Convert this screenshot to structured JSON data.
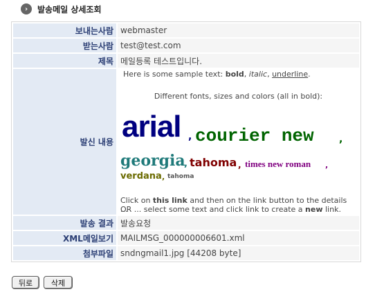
{
  "header": {
    "title": "발송메일 상세조회",
    "icon": "arrow-right-circle-icon"
  },
  "fields": {
    "sender_label": "보내는사람",
    "sender_value": "webmaster",
    "recipient_label": "받는사람",
    "recipient_value": "test@test.com",
    "subject_label": "제목",
    "subject_value": "메일등록 테스트입니다.",
    "content_label": "발신 내용",
    "result_label": "발송 결과",
    "result_value": "발송요청",
    "xml_label": "XML메일보기",
    "xml_value": "MAILMSG_000000006601.xml",
    "attach_label": "첨부파일",
    "attach_value": "sndngmail1.jpg [44208 byte]"
  },
  "content": {
    "intro_prefix": "Here is some sample text: ",
    "bold": "bold",
    "sep1": ", ",
    "italic": "italic",
    "sep2": ", ",
    "underline": "underline",
    "end": ".",
    "fonts_caption": "Different fonts, sizes and colors (all in bold):",
    "font_arial": "arial",
    "font_courier": "courier new",
    "font_georgia": "georgia",
    "font_tahoma": "tahoma",
    "font_times": "times new roman",
    "font_verdana": "verdana",
    "font_tahoma_small": "tahoma",
    "comma": ",",
    "link_line_prefix": "Click on ",
    "link_text": "this link",
    "link_line_suffix": " and then on the link button to the details ...",
    "select_line_prefix": "OR ... select some text and click link to create a ",
    "select_line_bold": "new",
    "select_line_suffix": " link."
  },
  "buttons": {
    "back": "뒤로",
    "delete": "삭제"
  },
  "colors": {
    "label_bg": "#e3eaf4",
    "label_text": "#2a3d73",
    "arial": "#000080",
    "courier": "#006400",
    "georgia": "#1f7a7a",
    "tahoma": "#800000",
    "times": "#800080",
    "verdana": "#6b6b00"
  }
}
